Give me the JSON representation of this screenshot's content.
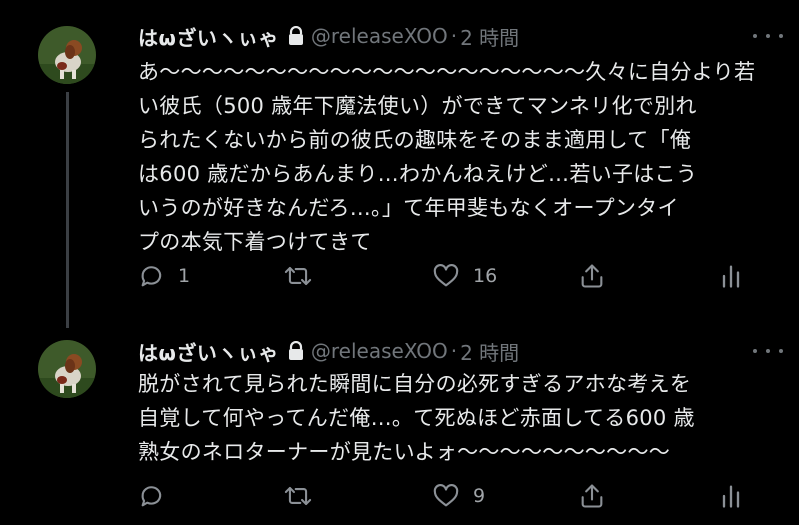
{
  "tweets": [
    {
      "display_name": "はωざいヽぃゃ",
      "handle": "@releaseXOO",
      "separator": "·",
      "time": "2 時間",
      "text": "あ〜〜〜〜〜〜〜〜〜〜〜〜〜〜〜〜〜〜〜〜久々に自分より若\nい彼氏（500 歳年下魔法使い）ができてマンネリ化で別れ\nられたくないから前の彼氏の趣味をそのまま適用して「俺\nは600 歳だからあんまり…わかんねえけど…若い子はこう\nいうのが好きなんだろ…。」て年甲斐もなくオープンタイ\nプの本気下着つけてきて",
      "reply_count": "1",
      "retweet_count": "",
      "like_count": "16"
    },
    {
      "display_name": "はωざいヽぃゃ",
      "handle": "@releaseXOO",
      "separator": "·",
      "time": "2 時間",
      "text": "脱がされて見られた瞬間に自分の必死すぎるアホな考えを\n自覚して何やってんだ俺…。て死ぬほど赤面してる600 歳\n熟女のネロターナーが見たいよォ〜〜〜〜〜〜〜〜〜〜",
      "reply_count": "",
      "retweet_count": "",
      "like_count": "9"
    }
  ],
  "icons": [
    "lock-icon",
    "more-icon",
    "reply-icon",
    "retweet-icon",
    "like-icon",
    "share-icon",
    "analytics-icon"
  ]
}
